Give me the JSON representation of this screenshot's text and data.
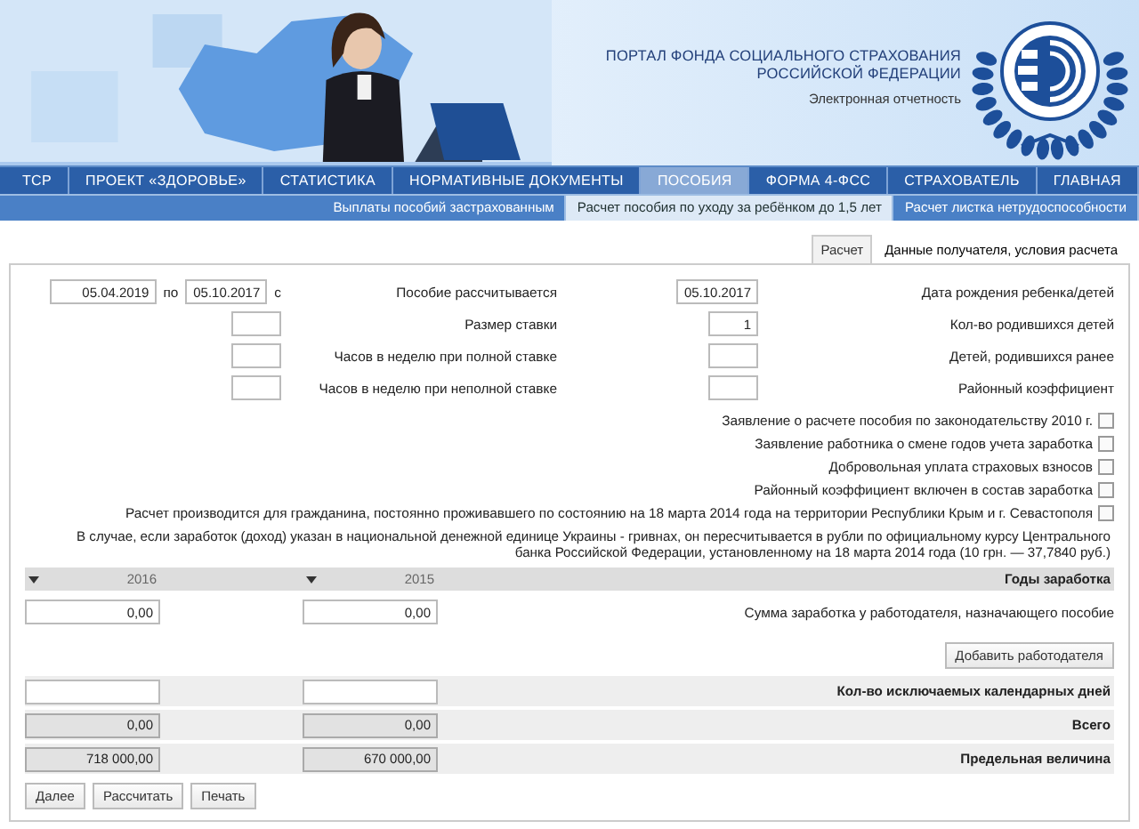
{
  "header": {
    "title_lines": [
      "ПОРТАЛ ФОНДА СОЦИАЛЬНОГО СТРАХОВАНИЯ",
      "РОССИЙСКОЙ ФЕДЕРАЦИИ"
    ],
    "subtitle": "Электронная отчетность"
  },
  "nav": [
    {
      "label": "ТСР",
      "selected": false
    },
    {
      "label": "ПРОЕКТ «ЗДОРОВЬЕ»",
      "selected": false
    },
    {
      "label": "СТАТИСТИКА",
      "selected": false
    },
    {
      "label": "НОРМАТИВНЫЕ ДОКУМЕНТЫ",
      "selected": false
    },
    {
      "label": "ПОСОБИЯ",
      "selected": true
    },
    {
      "label": "ФОРМА 4-ФСС",
      "selected": false
    },
    {
      "label": "СТРАХОВАТЕЛЬ",
      "selected": false
    },
    {
      "label": "ГЛАВНАЯ",
      "selected": false
    }
  ],
  "subnav": [
    {
      "label": "Выплаты пособий застрахованным",
      "selected": false
    },
    {
      "label": "Расчет пособия по уходу за ребёнком до 1,5 лет",
      "selected": true
    },
    {
      "label": "Расчет листка нетрудоспособности",
      "selected": false
    }
  ],
  "tabs": [
    {
      "label": "Расчет",
      "selected": false
    },
    {
      "label": "Данные получателя, условия расчета",
      "selected": true
    }
  ],
  "fields_left": [
    {
      "label": "Дата рождения ребенка/детей",
      "value": "05.10.2017",
      "kind": "date"
    },
    {
      "label": "Кол-во родившихся детей",
      "value": "1",
      "kind": "short"
    },
    {
      "label": "Детей, родившихся ранее",
      "kind": "short"
    },
    {
      "label": "Районный коэффициент",
      "kind": "short"
    }
  ],
  "fields_right": [
    {
      "label": "Пособие рассчитывается",
      "kind": "period",
      "from_label": "с",
      "from": "05.10.2017",
      "to_label": "по",
      "to": "05.04.2019"
    },
    {
      "label": "Размер ставки",
      "kind": "short"
    },
    {
      "label": "Часов в неделю при полной ставке",
      "kind": "short"
    },
    {
      "label": "Часов в неделю при неполной ставке",
      "kind": "short"
    }
  ],
  "checkboxes": [
    {
      "label": "Заявление о расчете пособия по законодательству 2010 г.",
      "checked": false
    },
    {
      "label": "Заявление работника о смене годов учета заработка",
      "checked": false
    },
    {
      "label": "Добровольная уплата страховых взносов",
      "checked": false
    },
    {
      "label": "Районный коэффициент включен в состав заработка",
      "checked": false
    },
    {
      "label": "Расчет производится для гражданина, постоянно проживавшего по состоянию на 18 марта 2014 года на территории Республики Крым и г. Севастополя",
      "checked": false
    }
  ],
  "note": "В случае, если заработок (доход) указан в национальной денежной единице Украины - гривнах, он пересчитывается в рубли по официальному курсу Центрального банка Российской Федерации, установленному на 18 марта 2014 года (10 грн. — 37,7840 руб.)",
  "earnings": {
    "years_label": "Годы заработка",
    "years": [
      "2016",
      "2015"
    ],
    "sum_row": {
      "label": "Сумма заработка у работодателя, назначающего пособие",
      "cells": [
        {
          "kind": "input",
          "value": "0,00"
        },
        {
          "kind": "input",
          "value": "0,00"
        }
      ]
    },
    "add_button": "Добавить работодателя",
    "summary_rows": [
      {
        "label": "Кол-во исключаемых календарных дней",
        "cells": [
          {
            "kind": "input"
          },
          {
            "kind": "input"
          }
        ]
      },
      {
        "label": "Всего",
        "cells": [
          {
            "kind": "readonly",
            "value": "0,00"
          },
          {
            "kind": "readonly",
            "value": "0,00"
          }
        ]
      },
      {
        "label": "Предельная величина",
        "cells": [
          {
            "kind": "readonly",
            "value": "718 000,00"
          },
          {
            "kind": "readonly",
            "value": "670 000,00"
          }
        ]
      }
    ]
  },
  "buttons": [
    "Далее",
    "Рассчитать",
    "Печать"
  ]
}
